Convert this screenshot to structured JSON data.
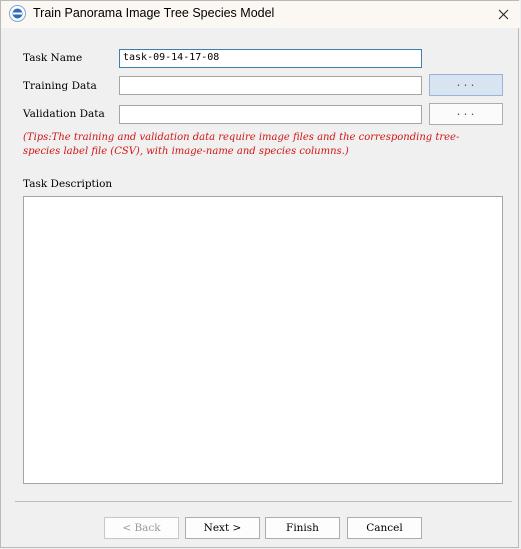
{
  "window": {
    "title": "Train Panorama Image Tree Species Model",
    "close_glyph": "✕"
  },
  "form": {
    "task_name": {
      "label": "Task Name",
      "value": "task-09-14-17-08"
    },
    "training_data": {
      "label": "Training Data",
      "value": "",
      "browse_label": "..."
    },
    "validation_data": {
      "label": "Validation Data",
      "value": "",
      "browse_label": "..."
    },
    "tips": "(Tips:The training and validation data require image files and the corresponding tree-species label file (CSV), with image-name and species columns.)",
    "description": {
      "label": "Task Description",
      "value": ""
    }
  },
  "buttons": {
    "back": "< Back",
    "next": "Next >",
    "finish": "Finish",
    "cancel": "Cancel"
  },
  "colors": {
    "tips": "#d01616",
    "focus_border": "#3c7fb1",
    "active_browse": "#d9e4f1"
  }
}
